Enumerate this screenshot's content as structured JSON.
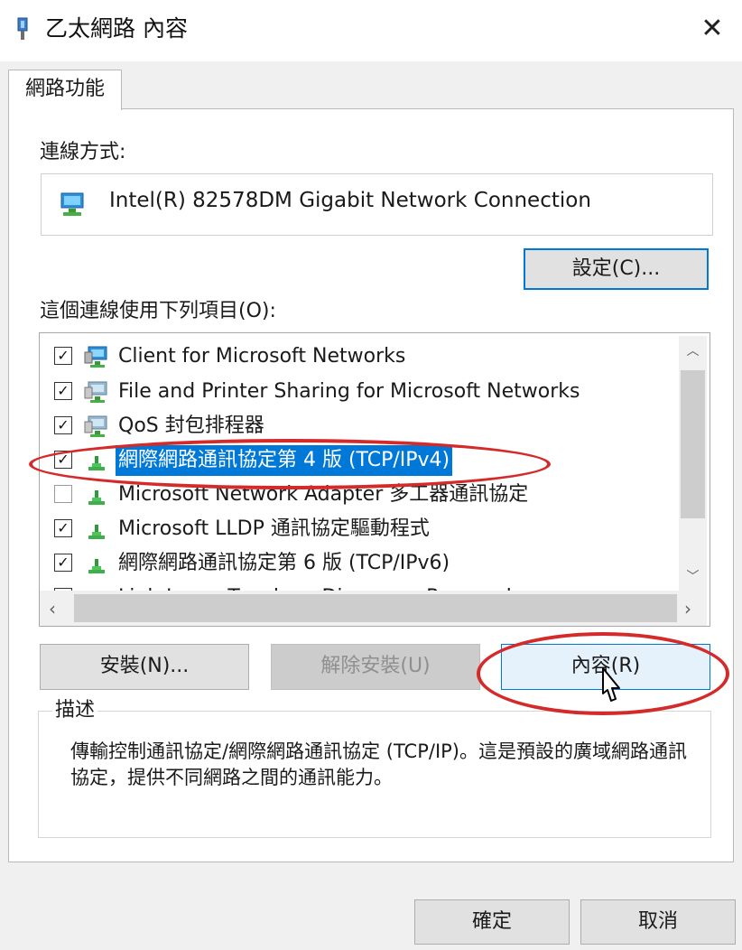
{
  "window": {
    "title": "乙太網路 內容",
    "close_glyph": "✕"
  },
  "tabs": [
    {
      "label": "網路功能",
      "selected": true
    }
  ],
  "connect_using": {
    "label": "連線方式:",
    "adapter_name": "Intel(R) 82578DM Gigabit Network Connection",
    "configure_button": "設定(C)..."
  },
  "items_section": {
    "label": "這個連線使用下列項目(O):",
    "items": [
      {
        "label": "Client for Microsoft Networks",
        "checked": true,
        "icon": "network-client-icon"
      },
      {
        "label": "File and Printer Sharing for Microsoft Networks",
        "checked": true,
        "icon": "network-service-icon"
      },
      {
        "label": "QoS 封包排程器",
        "checked": true,
        "icon": "network-service-icon"
      },
      {
        "label": "網際網路通訊協定第 4 版 (TCP/IPv4)",
        "checked": true,
        "selected": true,
        "icon": "protocol-icon"
      },
      {
        "label": "Microsoft Network Adapter 多工器通訊協定",
        "checked": false,
        "icon": "protocol-icon"
      },
      {
        "label": "Microsoft LLDP 通訊協定驅動程式",
        "checked": true,
        "icon": "protocol-icon"
      },
      {
        "label": "網際網路通訊協定第 6 版 (TCP/IPv6)",
        "checked": true,
        "icon": "protocol-icon"
      },
      {
        "label": "Link-Layer Topology Discovery Responder",
        "checked": true,
        "icon": "protocol-icon",
        "partially_visible": true
      }
    ]
  },
  "item_buttons": {
    "install": "安裝(N)...",
    "uninstall": "解除安裝(U)",
    "properties": "內容(R)"
  },
  "description": {
    "legend": "描述",
    "text": "傳輸控制通訊協定/網際網路通訊協定 (TCP/IP)。這是預設的廣域網路通訊協定，提供不同網路之間的通訊能力。"
  },
  "footer": {
    "ok": "確定",
    "cancel": "取消"
  },
  "colors": {
    "selection": "#0078d7",
    "annotation": "#d42a2a",
    "dialog_background": "#f0f0f0"
  },
  "annotations": [
    {
      "target": "tcp-ipv4-item",
      "shape": "ellipse"
    },
    {
      "target": "properties-button",
      "shape": "ellipse"
    }
  ]
}
